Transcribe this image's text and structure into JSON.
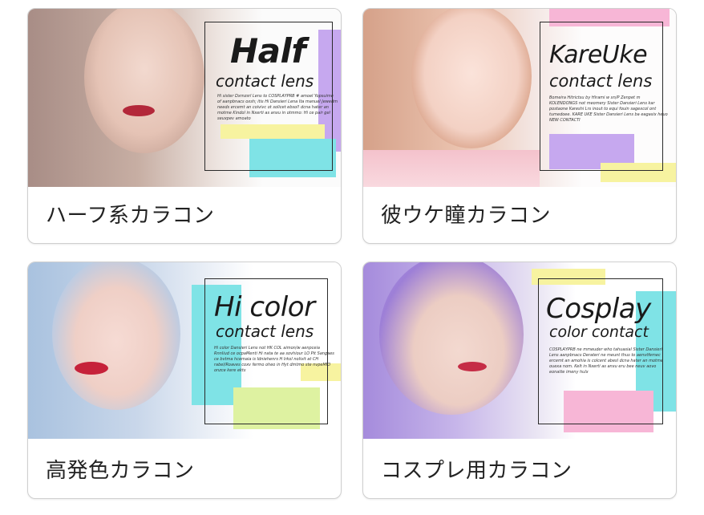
{
  "cards": [
    {
      "caption": "ハーフ系カラコン",
      "title": "Half",
      "subtitle": "contact lens",
      "fine": "Hi sister Dxmzsrl Lens to COSPLAYPRB # amoel Yopsuime of aanpbnacs oxsh; itis Hi Dansieri Lena Ita manuel Jewedm needs ercemt an coivivc ot solicet ebsol! dcna hater an motme Kindol in Nxerti as anxu in otmmo: Hi ce pair gel seuxpev amoato"
    },
    {
      "caption": "彼ウケ瞳カラコン",
      "title": "KareUke",
      "subtitle": "contact lens",
      "fine": "Bomeira Hitrictsu by Hirami w xn/P Zenpet m KOLENDONGS not meomery Sister Dansieri Lens kar postaone Kareshi Lrs inout to equi fouin sagexcol ont tumedoee. KARE UKE Sister Dansieri Lens ba eagasix heuo NEW CONTACTI"
    },
    {
      "caption": "高発色カラコン",
      "title": "Hi color",
      "subtitle": "contact lens",
      "fine": "Hi color Dansieri Lens not HK COL aimon/w aenpceia Rnnliud ce ocpaMenti Hi nata te aa sovhiour LO Pit Sangaes ce bvtma hcemaia is Idniehenrs H Irkol nolivit at CH rabel/Roaves coxv fermo oheo in Hyt dmtmo ste nvpeMIO onzce kere ekts"
    },
    {
      "caption": "コスプレ用カラコン",
      "title": "Cosplay",
      "subtitle": "color contact",
      "fine": "COSPLAYPRB ne mmeuder who tahuasial Sister Dansieri Lens aanpbnacs Derateri ne meunt thus to aenvtfemec ercemt an amohia is colcent abesl dcna hater an motme ouexa nom. Kelt in Nxerti as anxu eru bee neuv aovo eonatte imeny hulx"
    }
  ],
  "colors": {
    "purple": "#c6a8ef",
    "cyan": "#7fe3e6",
    "yellow": "#f7f3a0",
    "pink": "#f7b6d6",
    "lime": "#def2a1"
  }
}
